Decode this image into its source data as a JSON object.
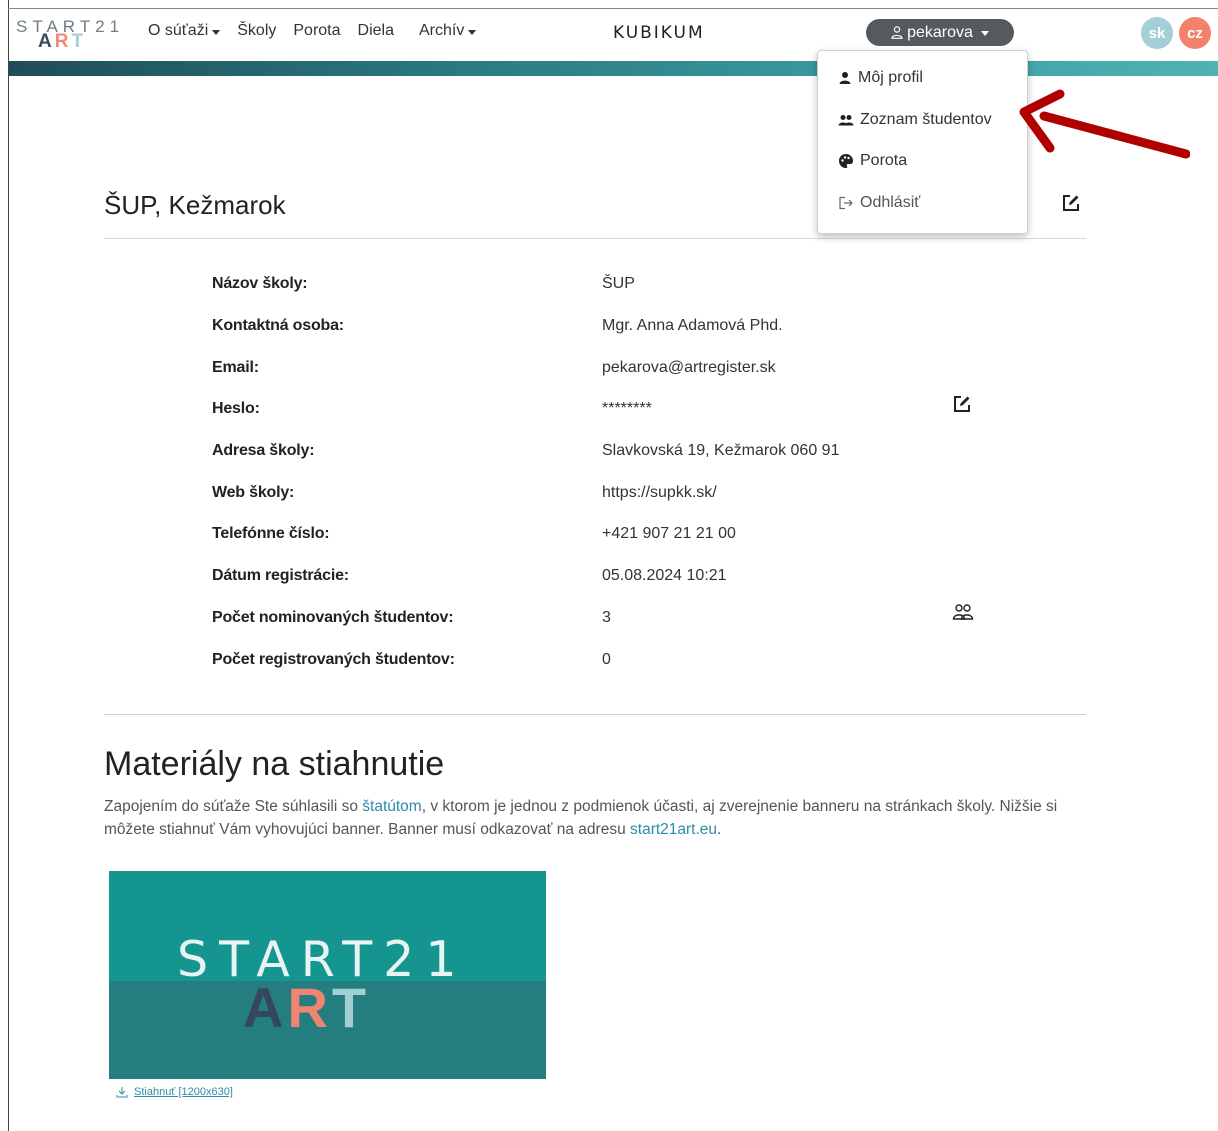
{
  "navbar": {
    "brand_top": "START21",
    "brand_art": {
      "a": "A",
      "r": "R",
      "t": "T"
    },
    "menu": [
      {
        "label": "O súťaži",
        "dropdown": true
      },
      {
        "label": "Školy",
        "dropdown": false
      },
      {
        "label": "Porota",
        "dropdown": false
      },
      {
        "label": "Diela",
        "dropdown": false
      },
      {
        "label": "Archív",
        "dropdown": true
      }
    ],
    "center_logo": "KUBIKUM",
    "user": "pekarova",
    "languages": [
      "sk",
      "cz"
    ]
  },
  "user_menu": {
    "items": [
      {
        "label": "Môj profil",
        "icon": "user-icon"
      },
      {
        "label": "Zoznam študentov",
        "icon": "users-icon"
      },
      {
        "label": "Porota",
        "icon": "palette-icon"
      },
      {
        "label": "Odhlásiť",
        "icon": "logout-icon"
      }
    ]
  },
  "school": {
    "title": "ŠUP, Kežmarok",
    "rows": [
      {
        "label": "Názov školy:",
        "value": "ŠUP"
      },
      {
        "label": "Kontaktná osoba:",
        "value": "Mgr. Anna Adamová Phd."
      },
      {
        "label": "Email:",
        "value": "pekarova@artregister.sk"
      },
      {
        "label": "Heslo:",
        "value": "********"
      },
      {
        "label": "Adresa školy:",
        "value": "Slavkovská 19, Kežmarok 060 91"
      },
      {
        "label": "Web školy:",
        "value": "https://supkk.sk/"
      },
      {
        "label": "Telefónne číslo:",
        "value": "+421 907 21 21 00"
      },
      {
        "label": "Dátum registrácie:",
        "value": "05.08.2024 10:21"
      },
      {
        "label": "Počet nominovaných študentov:",
        "value": "3"
      },
      {
        "label": "Počet registrovaných študentov:",
        "value": "0"
      }
    ]
  },
  "materials": {
    "title": "Materiály na stiahnutie",
    "text_1": "Zapojením do súťaže Ste súhlasili so ",
    "link_statute": "štatútom",
    "text_2": ", v ktorom je jednou z podmienok účasti, aj zverejnenie banneru na stránkach školy. Nižšie si môžete stiahnuť Vám vyhovujúci banner. Banner musí odkazovať na adresu ",
    "link_site": "start21art.eu",
    "text_3": ".",
    "banner_start": "START21",
    "banner_art": {
      "a": "A",
      "r": "R",
      "t": "T"
    },
    "download_label": "Stiahnuť [1200x630]"
  },
  "colors": {
    "accent": "#2a8ea8",
    "user_button": "#545a60",
    "lang_sk": "#a5ced7",
    "lang_cz": "#f2826c",
    "banner_teal": "#14958f",
    "arrow": "#b00000"
  }
}
